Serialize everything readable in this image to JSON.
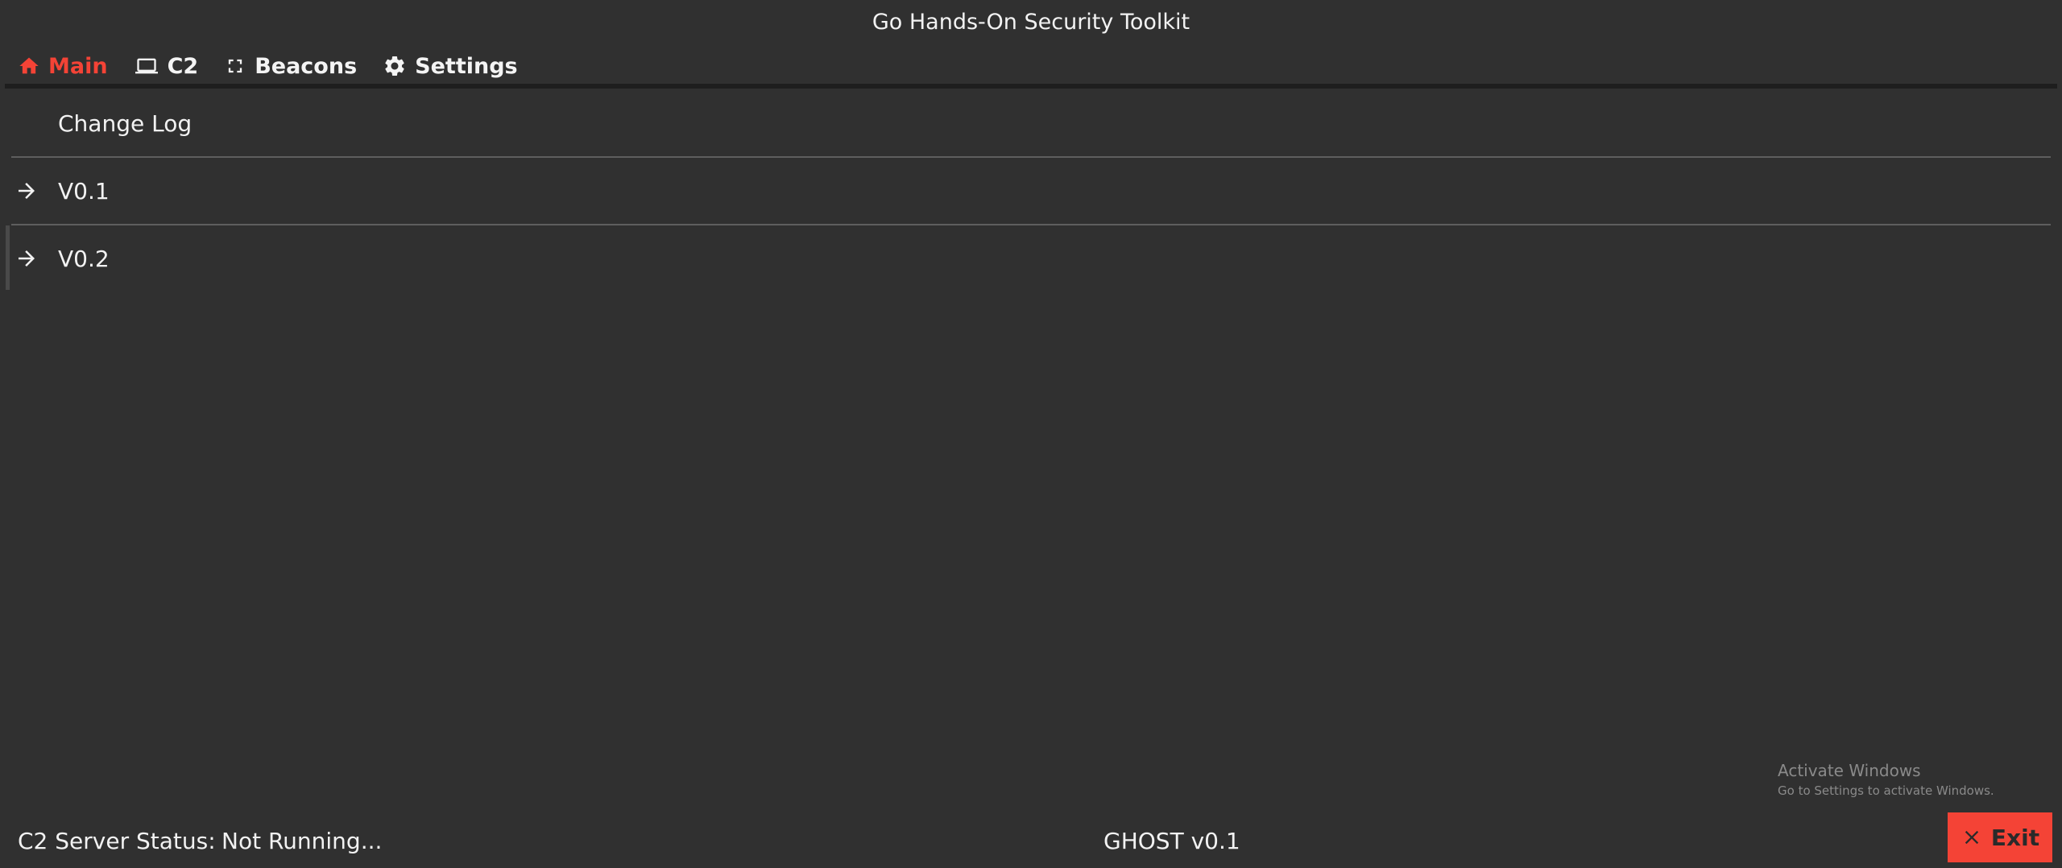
{
  "window": {
    "title": "Go Hands-On Security Toolkit"
  },
  "tabs": [
    {
      "label": "Main",
      "icon": "home-icon",
      "active": true
    },
    {
      "label": "C2",
      "icon": "laptop-icon",
      "active": false
    },
    {
      "label": "Beacons",
      "icon": "fullscreen-icon",
      "active": false
    },
    {
      "label": "Settings",
      "icon": "gear-icon",
      "active": false
    }
  ],
  "changelog": {
    "header": "Change Log",
    "items": [
      {
        "label": "V0.1",
        "icon": "arrow-right-icon"
      },
      {
        "label": "V0.2",
        "icon": "arrow-right-icon"
      }
    ]
  },
  "watermark": {
    "title": "Activate Windows",
    "subtitle": "Go to Settings to activate Windows."
  },
  "status": {
    "label": "C2 Server Status:",
    "value": "Not Running...",
    "app_version": "GHOST v0.1",
    "exit_label": "Exit"
  },
  "colors": {
    "accent": "#f44336",
    "background": "#303030",
    "text": "#f2f2f2",
    "divider": "#5e5e5e"
  }
}
